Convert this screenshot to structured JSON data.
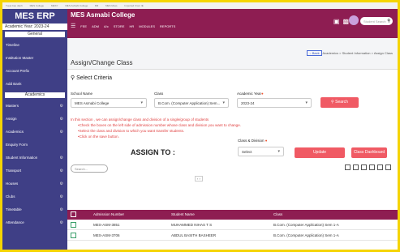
{
  "bookmarks": [
    "Tuyet bao danh",
    "MES College",
    "MESY",
    "MES Ashiabi College",
    "Bill",
    "MES Mess",
    "Imported From IE"
  ],
  "sidebar": {
    "logo": "MES ERP",
    "academic_year": "Academic Year: 2023-24",
    "section_general": "General",
    "general_items": [
      "Timeline",
      "Institution Master",
      "Account Prefix",
      "Add Bank"
    ],
    "section_academics": "Academics",
    "academic_items": [
      "Masters",
      "Assign",
      "Academics",
      "Enquiry Form",
      "Student Information",
      "Transport",
      "Houses",
      "Clubs",
      "Timetable",
      "Attendance"
    ]
  },
  "topbar": {
    "college": "MES Asmabi College",
    "menu": [
      "FEE",
      "ADM",
      "A/c",
      "STORE",
      "HR",
      "MODULES",
      "REPORTS"
    ],
    "search_placeholder": "Student Search"
  },
  "page": {
    "title": "Assign/Change Class",
    "back": "Back",
    "breadcrumb": "Academics > Student Information > Assign Class"
  },
  "criteria": {
    "heading": "Select Criteria",
    "school_label": "School Name",
    "school_value": "MES Asmabi College",
    "class_label": "Class",
    "class_value": "B.Com. (Computer Application) Sem...",
    "year_label": "Academic Year",
    "year_value": "2023-24",
    "search_button": "Search"
  },
  "instructions": {
    "intro": "In this section , we can assign/change class and division of a single/group of students",
    "steps": [
      "Check the boxes on the left side of admission number whose class and division you want to change.",
      "Select the class and division to which you want transfer students.",
      "Click on the save button."
    ]
  },
  "assign": {
    "title": "ASSIGN TO :",
    "class_division_label": "Class & Division",
    "select_placeholder": "Select",
    "update_button": "Update",
    "dashboard_button": "Class Dashboard"
  },
  "table": {
    "search_placeholder": "Search...",
    "headers": [
      "Admission Number",
      "Student Name",
      "Class"
    ],
    "rows": [
      {
        "adm": "MES-ASM-3851",
        "name": "MUHAMMED NIHAS T S",
        "class": "B.Com. (Computer Application) Sem 1-A"
      },
      {
        "adm": "MES-ASM-3706",
        "name": "ABDUL BASITH BASHEER",
        "class": "B.Com. (Computer Application) Sem 1-A"
      }
    ]
  },
  "colors": {
    "primary": "#8e1d52",
    "sidebar": "#3f3f86",
    "accent": "#f05a64"
  }
}
